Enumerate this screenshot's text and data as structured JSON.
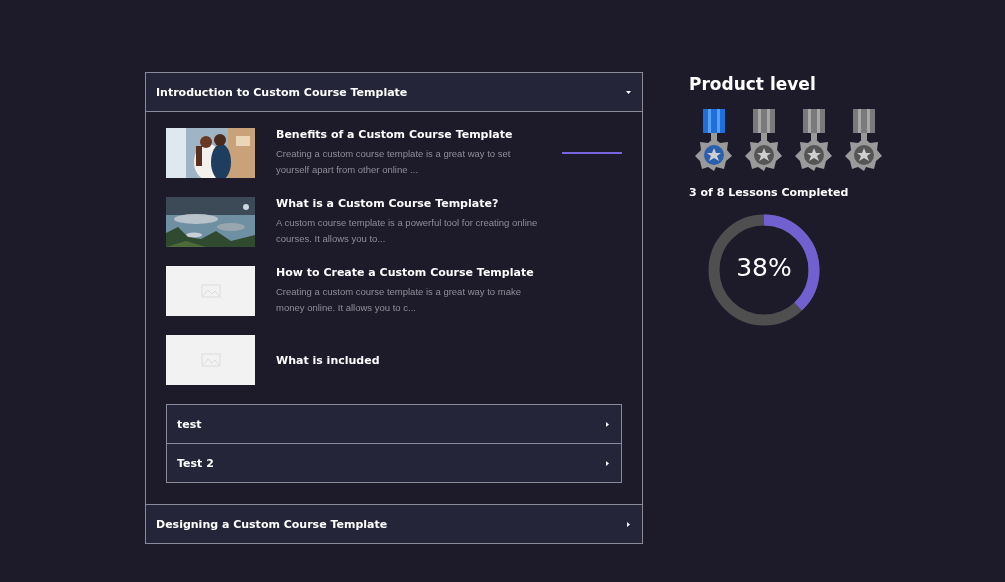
{
  "sections": [
    {
      "title": "Introduction to Custom Course Template",
      "expanded": true,
      "lessons": [
        {
          "title": "Benefits of a Custom Course Template",
          "excerpt": "Creating a custom course template is a great way to set yourself apart from other online ...",
          "active": true
        },
        {
          "title": "What is a Custom Course Template?",
          "excerpt": "A custom course template is a powerful tool for creating online courses. It allows you to...",
          "active": false
        },
        {
          "title": "How to Create a Custom Course Template",
          "excerpt": "Creating a custom course template is a great way to make money online. It allows you to c...",
          "kind": "placeholder",
          "active": false
        },
        {
          "title": "What is included",
          "kind": "placeholder",
          "active": false
        }
      ],
      "subsections": [
        {
          "title": "test",
          "expanded": false
        },
        {
          "title": "Test 2",
          "expanded": false
        }
      ]
    },
    {
      "title": "Designing a Custom Course Template",
      "expanded": false
    }
  ],
  "level_panel": {
    "title": "Product level",
    "medals": [
      {
        "earned": true
      },
      {
        "earned": false
      },
      {
        "earned": false
      },
      {
        "earned": false
      }
    ],
    "completed": "3 of 8 Lessons Completed",
    "progress": {
      "level": 0.38,
      "reading": "38%"
    }
  }
}
